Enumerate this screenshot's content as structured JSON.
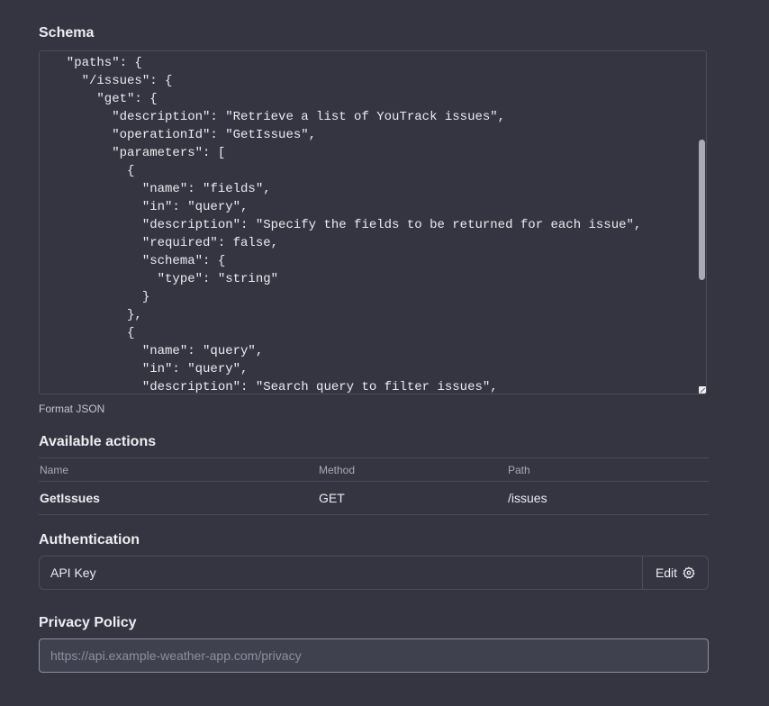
{
  "schema": {
    "label": "Schema",
    "code": "  ],\n  \"paths\": {\n    \"/issues\": {\n      \"get\": {\n        \"description\": \"Retrieve a list of YouTrack issues\",\n        \"operationId\": \"GetIssues\",\n        \"parameters\": [\n          {\n            \"name\": \"fields\",\n            \"in\": \"query\",\n            \"description\": \"Specify the fields to be returned for each issue\",\n            \"required\": false,\n            \"schema\": {\n              \"type\": \"string\"\n            }\n          },\n          {\n            \"name\": \"query\",\n            \"in\": \"query\",\n            \"description\": \"Search query to filter issues\",",
    "format_label": "Format JSON"
  },
  "actions": {
    "label": "Available actions",
    "columns": [
      "Name",
      "Method",
      "Path"
    ],
    "rows": [
      {
        "name": "GetIssues",
        "method": "GET",
        "path": "/issues"
      }
    ]
  },
  "authentication": {
    "label": "Authentication",
    "value": "API Key",
    "edit_label": "Edit",
    "edit_icon": "gear-icon"
  },
  "privacy": {
    "label": "Privacy Policy",
    "placeholder": "https://api.example-weather-app.com/privacy",
    "value": ""
  },
  "colors": {
    "background": "#343541",
    "border": "#4d4d57",
    "text": "#ececf1",
    "muted": "#a9a9b3",
    "input_bg": "#40414f"
  }
}
